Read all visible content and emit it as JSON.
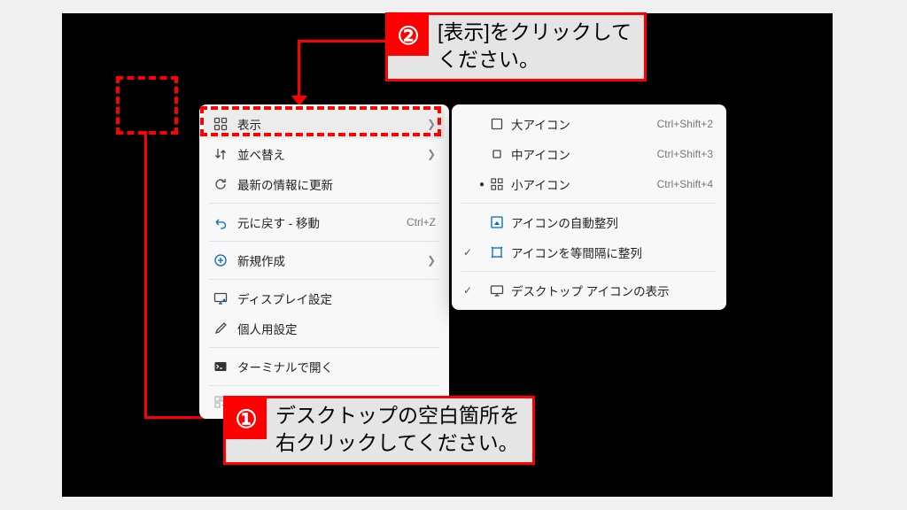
{
  "contextMenu": {
    "items": [
      {
        "label": "表示",
        "hasSubmenu": true
      },
      {
        "label": "並べ替え",
        "hasSubmenu": true
      },
      {
        "label": "最新の情報に更新"
      },
      {
        "label": "元に戻す - 移動",
        "shortcut": "Ctrl+Z"
      },
      {
        "label": "新規作成",
        "hasSubmenu": true
      },
      {
        "label": "ディスプレイ設定"
      },
      {
        "label": "個人用設定"
      },
      {
        "label": "ターミナルで開く"
      }
    ]
  },
  "viewSubmenu": {
    "items": [
      {
        "label": "大アイコン",
        "shortcut": "Ctrl+Shift+2"
      },
      {
        "label": "中アイコン",
        "shortcut": "Ctrl+Shift+3"
      },
      {
        "label": "小アイコン",
        "shortcut": "Ctrl+Shift+4",
        "selected": true
      },
      {
        "label": "アイコンの自動整列"
      },
      {
        "label": "アイコンを等間隔に整列",
        "checked": true
      },
      {
        "label": "デスクトップ アイコンの表示",
        "checked": true
      }
    ]
  },
  "callouts": {
    "step1": {
      "num": "①",
      "text": "デスクトップの空白箇所を\n右クリックしてください。"
    },
    "step2": {
      "num": "②",
      "text": "[表示]をクリックして\nください。"
    }
  }
}
